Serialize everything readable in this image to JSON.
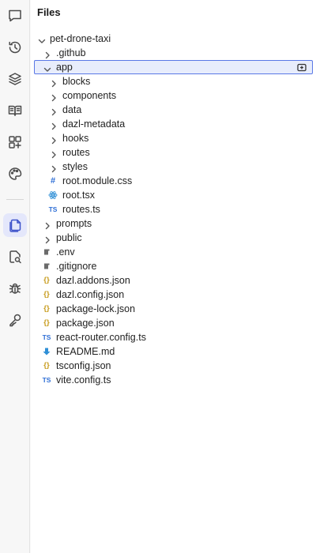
{
  "explorer": {
    "title": "Files"
  },
  "tree": {
    "root": "pet-drone-taxi",
    "github": ".github",
    "app": "app",
    "app_children": {
      "blocks": "blocks",
      "components": "components",
      "data": "data",
      "dazl_metadata": "dazl-metadata",
      "hooks": "hooks",
      "routes": "routes",
      "styles": "styles",
      "root_module_css": "root.module.css",
      "root_tsx": "root.tsx",
      "routes_ts": "routes.ts"
    },
    "prompts": "prompts",
    "public": "public",
    "env": ".env",
    "gitignore": ".gitignore",
    "dazl_addons": "dazl.addons.json",
    "dazl_config": "dazl.config.json",
    "package_lock": "package-lock.json",
    "package_json": "package.json",
    "react_router_config": "react-router.config.ts",
    "readme": "README.md",
    "tsconfig": "tsconfig.json",
    "vite_config": "vite.config.ts"
  },
  "icons": {
    "ts_glyph": "TS",
    "css_glyph": "#",
    "json_glyph": "{}"
  },
  "colors": {
    "accent": "#3d52c9",
    "selection_bg": "#e8edfc",
    "selection_border": "#5a78e6"
  }
}
